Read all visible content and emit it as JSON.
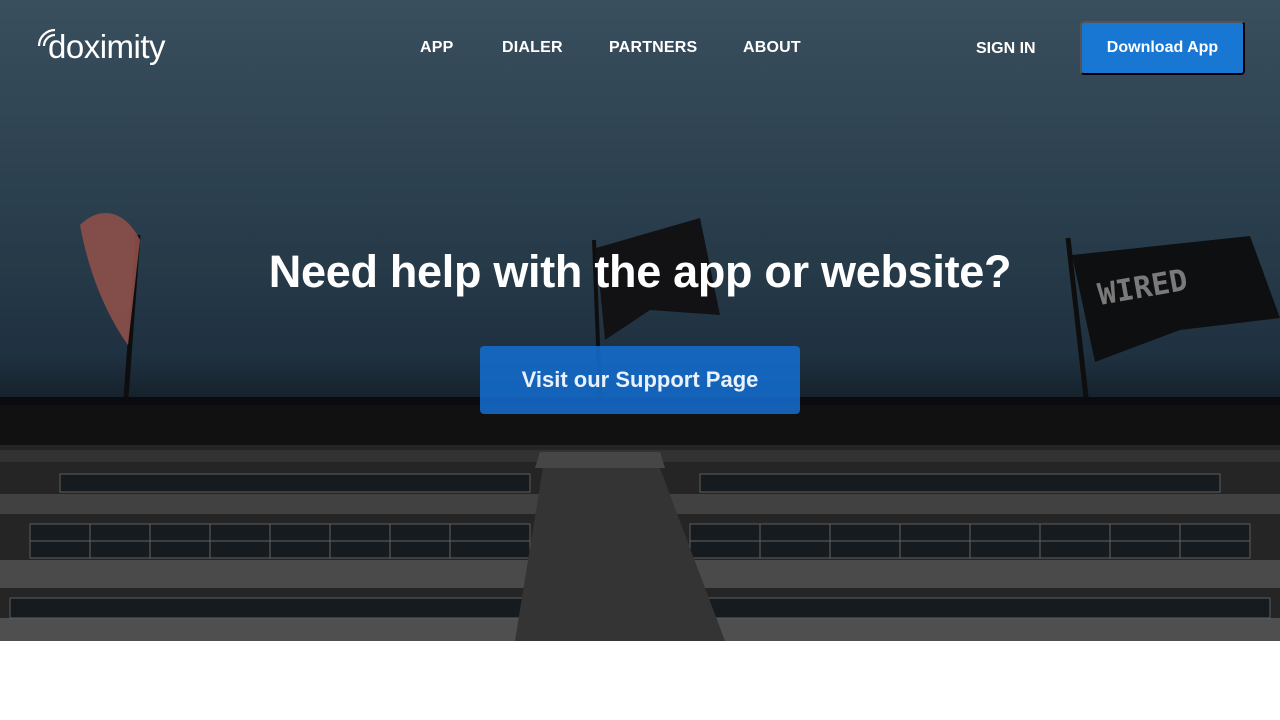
{
  "header": {
    "logo_text": "doximity",
    "nav": [
      {
        "label": "APP"
      },
      {
        "label": "DIALER"
      },
      {
        "label": "PARTNERS"
      },
      {
        "label": "ABOUT"
      }
    ],
    "sign_in_label": "SIGN IN",
    "download_label": "Download App"
  },
  "hero": {
    "title": "Need help with the app or website?",
    "cta_label": "Visit our Support Page",
    "background_image": "office-building-with-flags",
    "flag_text": "WIRED"
  },
  "colors": {
    "primary_blue": "#1877d3",
    "text_white": "#ffffff",
    "page_background": "#ffffff"
  }
}
